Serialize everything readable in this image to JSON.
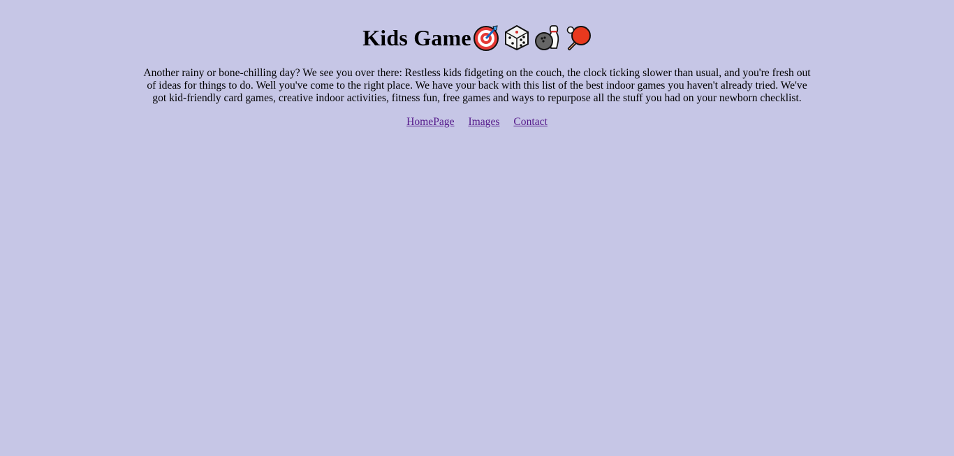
{
  "header": {
    "title": "Kids Game",
    "emojis": [
      "direct-hit-icon",
      "game-die-icon",
      "bowling-icon",
      "ping-pong-icon"
    ]
  },
  "intro": {
    "text": "Another rainy or bone-chilling day? We see you over there: Restless kids fidgeting on the couch, the clock ticking slower than usual, and you're fresh out of ideas for things to do. Well you've come to the right place. We have your back with this list of the best indoor games you haven't already tried. We've got kid-friendly card games, creative indoor activities, fitness fun, free games and ways to repurpose all the stuff you had on your newborn checklist."
  },
  "nav": {
    "links": [
      {
        "label": "HomePage"
      },
      {
        "label": "Images"
      },
      {
        "label": "Contact"
      }
    ]
  },
  "colors": {
    "background": "#c6c6e6",
    "link_visited": "#551a8b"
  }
}
